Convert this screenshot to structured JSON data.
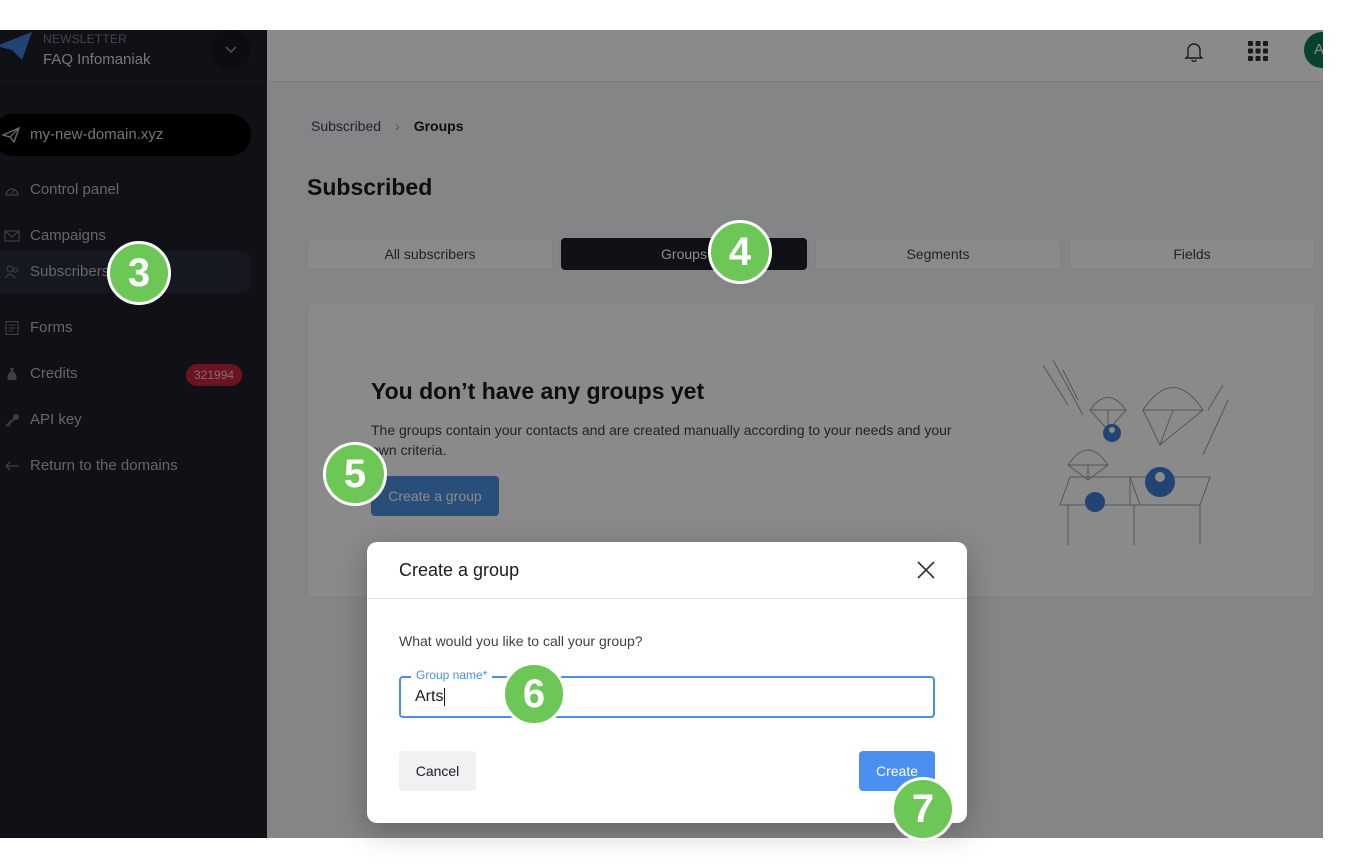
{
  "sidebar": {
    "brand_small": "NEWSLETTER",
    "brand_name": "FAQ Infomaniak",
    "domain": "my-new-domain.xyz",
    "items": [
      {
        "label": "Control panel",
        "icon": "gauge-icon"
      },
      {
        "label": "Campaigns",
        "icon": "envelope-icon"
      },
      {
        "label": "Subscribers",
        "icon": "users-icon",
        "active": true
      },
      {
        "label": "Forms",
        "icon": "form-icon"
      },
      {
        "label": "Credits",
        "icon": "money-bag-icon",
        "badge": "321994"
      },
      {
        "label": "API key",
        "icon": "key-icon"
      },
      {
        "label": "Return to the domains",
        "icon": "arrow-left-icon"
      }
    ]
  },
  "topbar": {
    "avatar_initial": "A"
  },
  "breadcrumb": {
    "parent": "Subscribed",
    "current": "Groups"
  },
  "page": {
    "title": "Subscribed"
  },
  "tabs": [
    {
      "label": "All subscribers",
      "active": false
    },
    {
      "label": "Groups",
      "active": true
    },
    {
      "label": "Segments",
      "active": false
    },
    {
      "label": "Fields",
      "active": false
    }
  ],
  "empty_state": {
    "title": "You don’t have any groups yet",
    "description": "The groups contain your contacts and are created manually according to your needs and your own criteria.",
    "button": "Create a group"
  },
  "modal": {
    "title": "Create a group",
    "question": "What would you like to call your group?",
    "field_label": "Group name*",
    "field_value": "Arts",
    "cancel": "Cancel",
    "create": "Create"
  },
  "steps": [
    "3",
    "4",
    "5",
    "6",
    "7"
  ],
  "colors": {
    "sidebar_bg": "#1c2029",
    "accent_blue": "#4a90e2",
    "badge_red": "#c8243d",
    "step_green": "#6cc756",
    "avatar_green": "#0d7a52"
  }
}
